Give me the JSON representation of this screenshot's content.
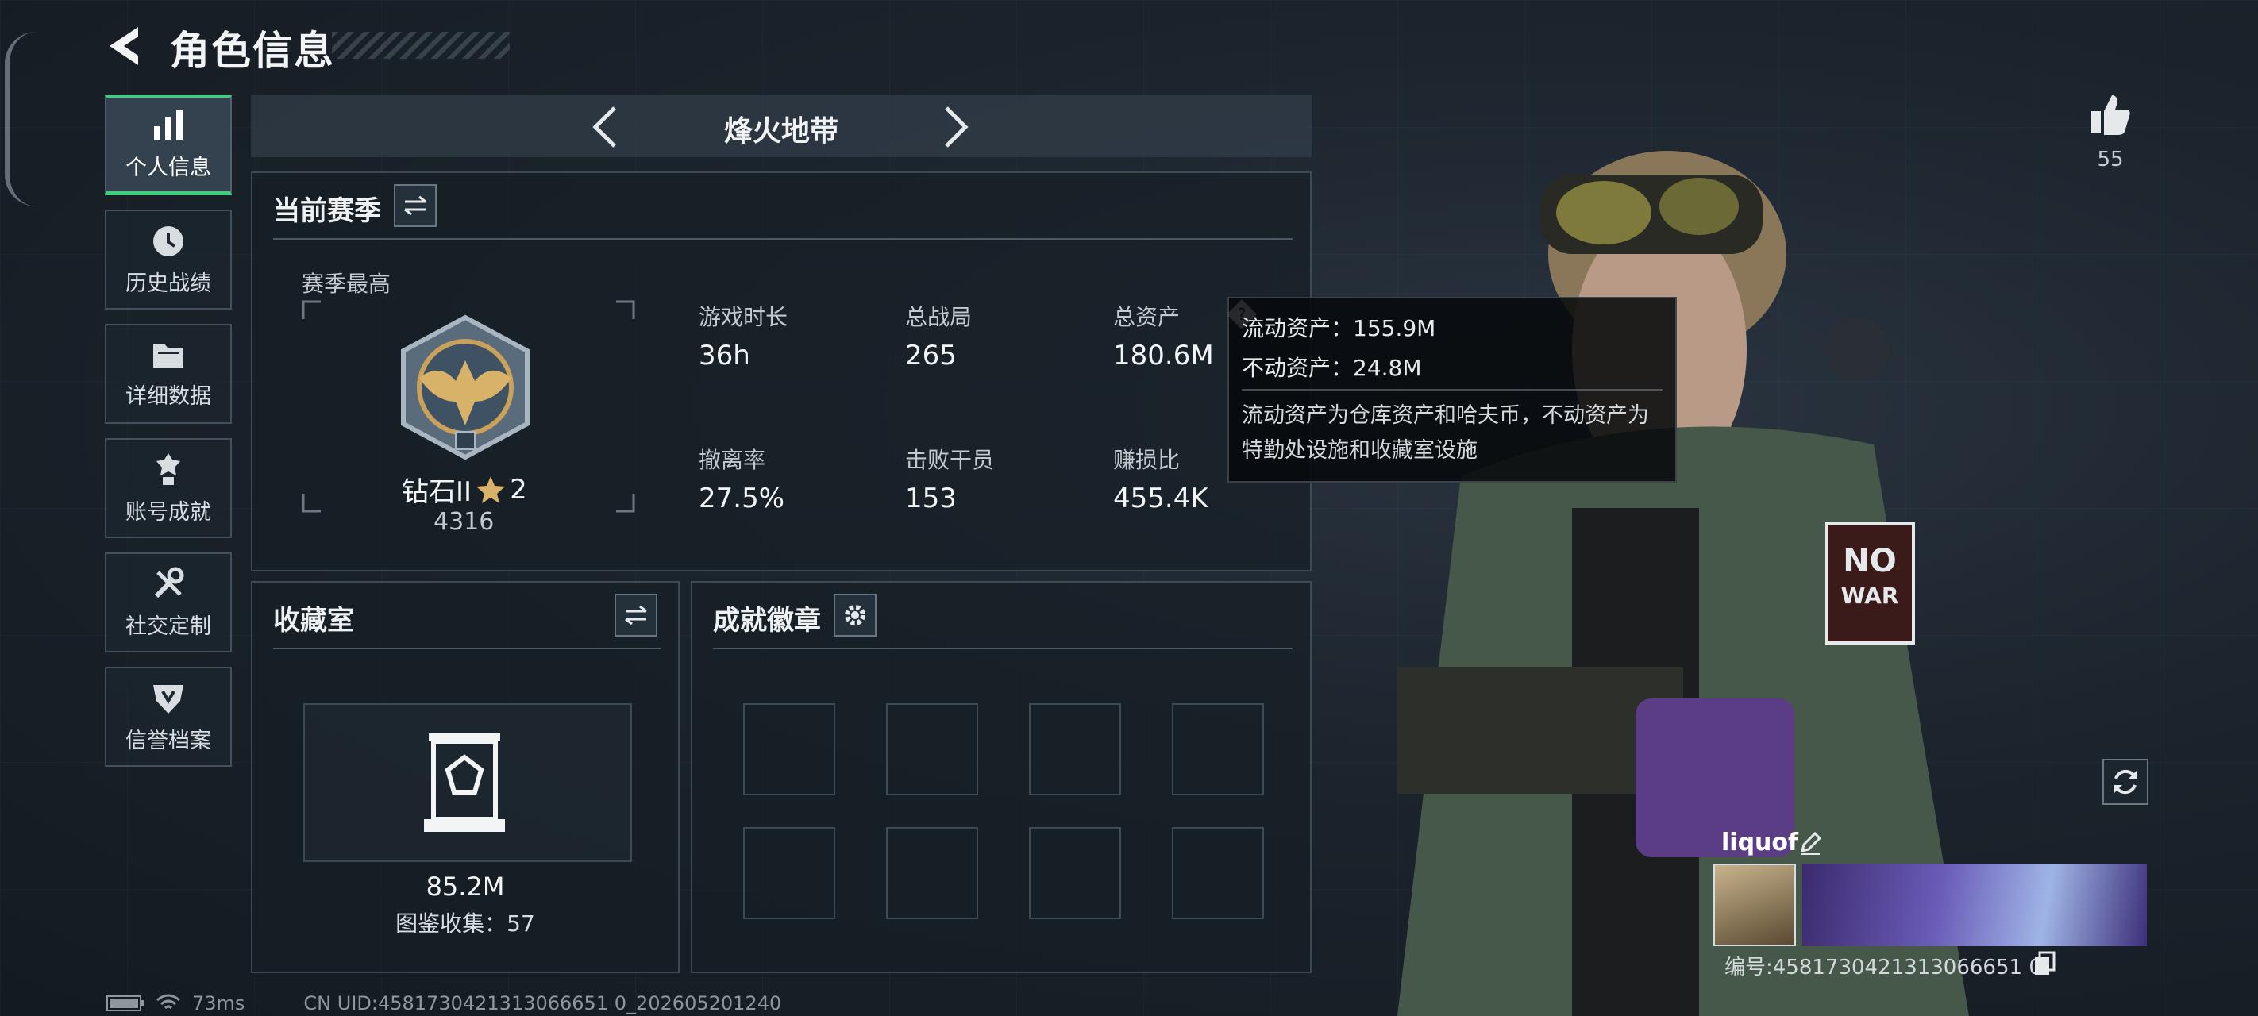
{
  "header": {
    "title": "角色信息",
    "back_icon": "back-arrow-icon"
  },
  "sidebar": {
    "items": [
      {
        "label": "个人信息",
        "icon": "bar-chart-icon",
        "active": true
      },
      {
        "label": "历史战绩",
        "icon": "clock-icon",
        "active": false
      },
      {
        "label": "详细数据",
        "icon": "folder-icon",
        "active": false
      },
      {
        "label": "账号成就",
        "icon": "medal-icon",
        "active": false
      },
      {
        "label": "社交定制",
        "icon": "tools-icon",
        "active": false
      },
      {
        "label": "信誉档案",
        "icon": "shield-icon",
        "active": false
      }
    ]
  },
  "mode": {
    "name": "烽火地带"
  },
  "season": {
    "title": "当前赛季",
    "best_label": "赛季最高",
    "rank_name": "钻石II",
    "rank_stars": "2",
    "rank_score": "4316",
    "stats": [
      {
        "label": "游戏时长",
        "value": "36h"
      },
      {
        "label": "总战局",
        "value": "265"
      },
      {
        "label": "总资产",
        "value": "180.6M"
      },
      {
        "label": "撤离率",
        "value": "27.5%"
      },
      {
        "label": "击败干员",
        "value": "153"
      },
      {
        "label": "赚损比",
        "value": "455.4K"
      }
    ]
  },
  "tooltip": {
    "liquid": "流动资产：155.9M",
    "fixed": "不动资产：24.8M",
    "desc": "流动资产为仓库资产和哈夫币，不动资产为特勤处设施和收藏室设施"
  },
  "collection": {
    "title": "收藏室",
    "value": "85.2M",
    "count_label": "图鉴收集：57"
  },
  "achievements": {
    "title": "成就徽章"
  },
  "profile": {
    "like_count": "55",
    "player_name": "liquof",
    "player_id": "编号:4581730421313066651 0"
  },
  "status": {
    "ping": "73ms",
    "uid": "CN UID:4581730421313066651 0_202605201240"
  },
  "colors": {
    "accent_green": "#3ecf7a",
    "panel_bg": "#161e26"
  }
}
